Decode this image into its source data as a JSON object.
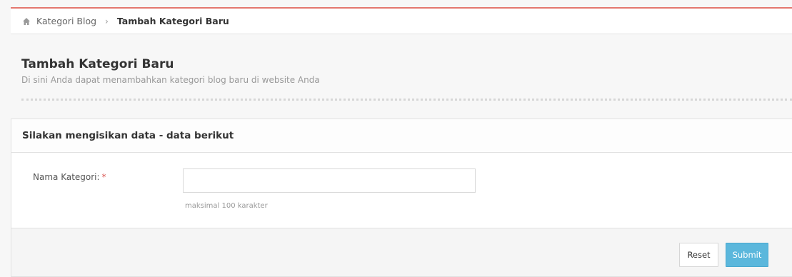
{
  "breadcrumb": {
    "parent": "Kategori Blog",
    "separator": "›",
    "current": "Tambah Kategori Baru"
  },
  "heading": {
    "title": "Tambah Kategori Baru",
    "subtitle": "Di sini Anda dapat menambahkan kategori blog baru di website Anda"
  },
  "panel": {
    "title": "Silakan mengisikan data - data berikut",
    "field": {
      "label": "Nama Kategori:",
      "required": "*",
      "value": "",
      "help": "maksimal 100 karakter"
    },
    "buttons": {
      "reset": "Reset",
      "submit": "Submit"
    }
  },
  "colors": {
    "accent_top": "#e4776e",
    "submit": "#5bb7dc",
    "required": "#d9534f"
  },
  "icons": {
    "breadcrumb_home": "home-icon"
  }
}
